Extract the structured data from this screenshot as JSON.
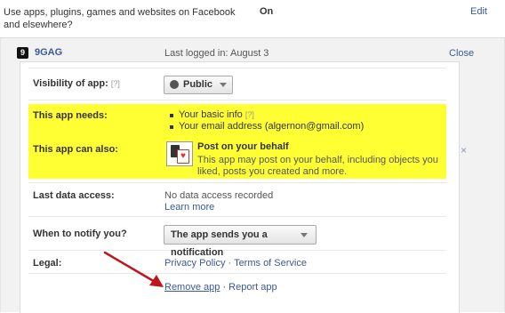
{
  "top_row": {
    "description": "Use apps, plugins, games and websites on Facebook and elsewhere?",
    "status": "On",
    "edit_label": "Edit"
  },
  "app": {
    "logo_glyph": "9",
    "name": "9GAG",
    "last_logged_in": "Last logged in: August 3",
    "close_label": "Close"
  },
  "visibility": {
    "label": "Visibility of app:",
    "hint": "[?]",
    "value": "Public"
  },
  "needs": {
    "label": "This app needs:",
    "items": [
      {
        "text": "Your basic info",
        "hint": "[?]"
      },
      {
        "text": "Your email address (algernon@gmail.com)",
        "hint": ""
      }
    ]
  },
  "also": {
    "label": "This app can also:",
    "permission_title": "Post on your behalf",
    "permission_desc": "This app may post on your behalf, including objects you liked, posts you created and more.",
    "remove_icon": "×"
  },
  "last_access": {
    "label": "Last data access:",
    "value": "No data access recorded",
    "learn_more": "Learn more"
  },
  "notify": {
    "label": "When to notify you?",
    "value": "The app sends you a notification"
  },
  "legal": {
    "label": "Legal:",
    "privacy": "Privacy Policy",
    "sep": "·",
    "terms": "Terms of Service"
  },
  "footer": {
    "remove": "Remove app",
    "sep": "·",
    "report": "Report app"
  },
  "colors": {
    "link": "#3b5998",
    "highlight": "#ffff33",
    "arrow": "#c0151b"
  }
}
